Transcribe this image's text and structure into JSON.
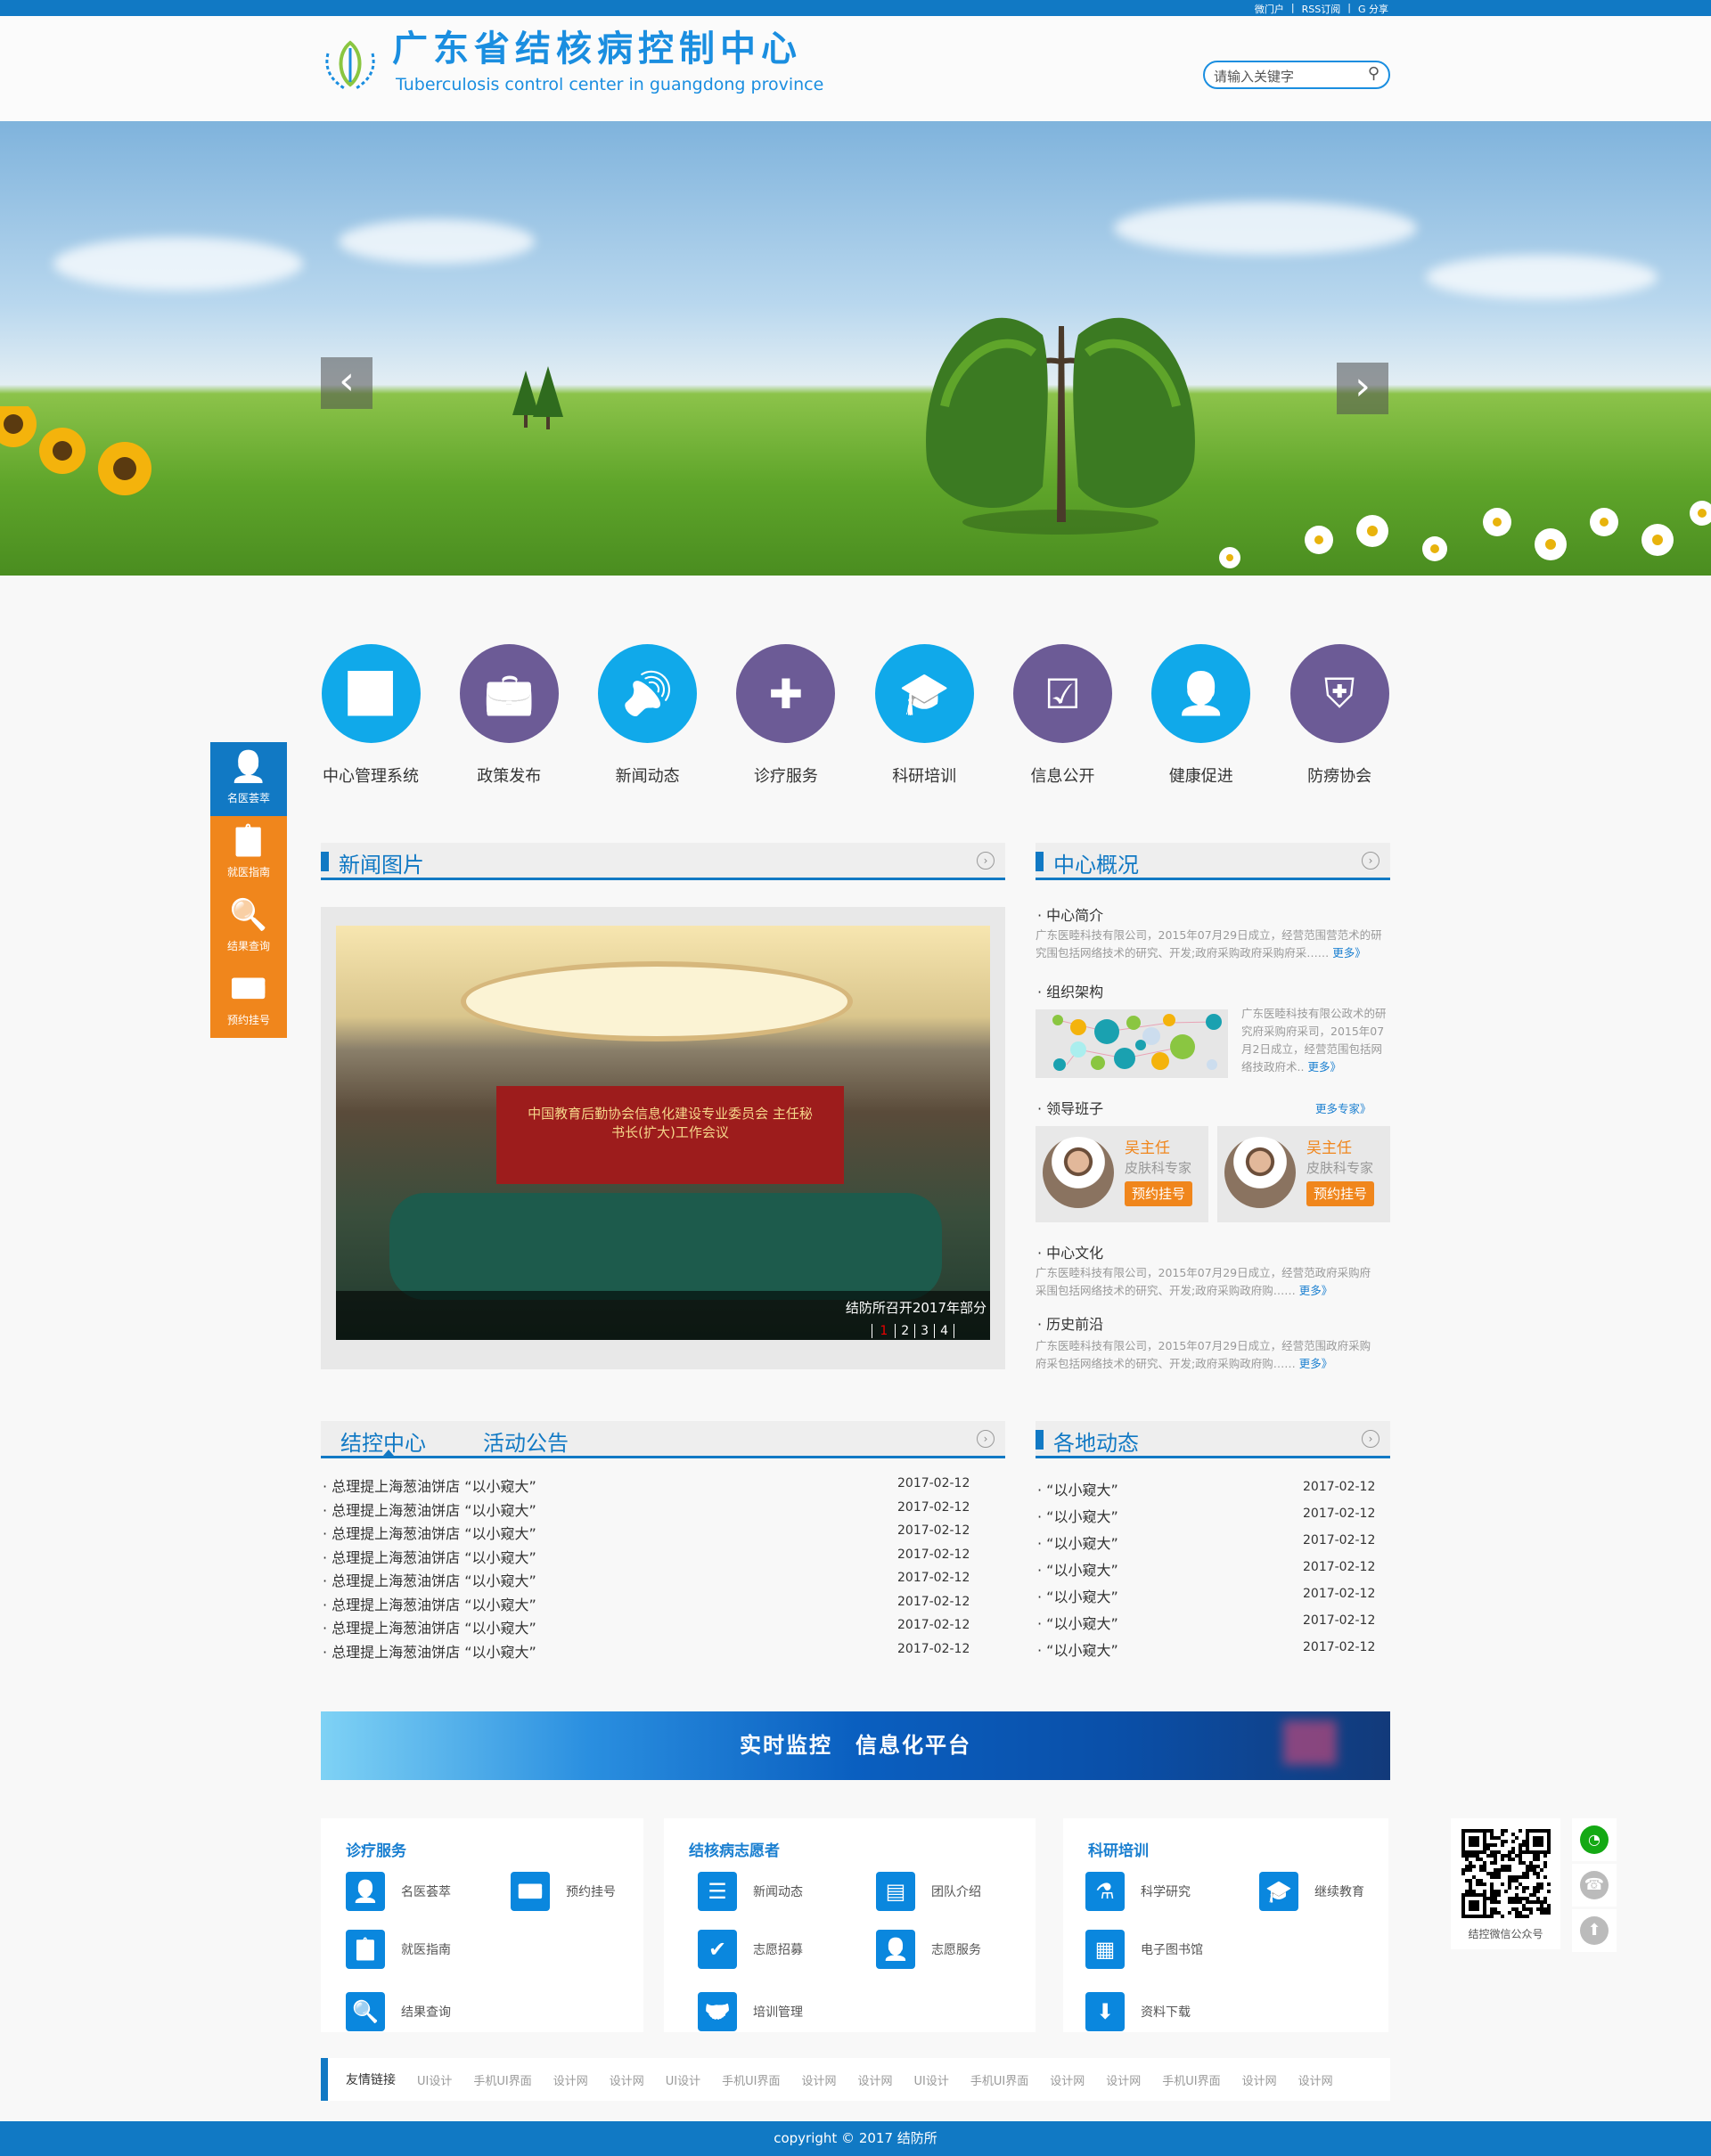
{
  "topbar": {
    "links": [
      "微门户",
      "RSS订阅",
      "分享"
    ]
  },
  "header": {
    "title_cn": "广东省结核病控制中心",
    "title_en": "Tuberculosis control center in guangdong province",
    "search_placeholder": "请输入关键字"
  },
  "hero": {
    "prev": "‹",
    "next": "›"
  },
  "nav": [
    {
      "label": "中心管理系统",
      "icon": "chart-growth-icon",
      "color": "#10a9ea"
    },
    {
      "label": "政策发布",
      "icon": "briefcase-icon",
      "color": "#6c5b96"
    },
    {
      "label": "新闻动态",
      "icon": "speaker-icon",
      "color": "#10a9ea"
    },
    {
      "label": "诊疗服务",
      "icon": "medical-kit-icon",
      "color": "#6c5b96"
    },
    {
      "label": "科研培训",
      "icon": "graduation-cap-icon",
      "color": "#10a9ea"
    },
    {
      "label": "信息公开",
      "icon": "document-check-icon",
      "color": "#6c5b96"
    },
    {
      "label": "健康促进",
      "icon": "doctor-icon",
      "color": "#10a9ea"
    },
    {
      "label": "防痨协会",
      "icon": "shield-cross-icon",
      "color": "#6c5b96"
    }
  ],
  "sidebar": [
    {
      "label": "名医荟萃",
      "icon": "doctor-icon",
      "color": "#1179c4"
    },
    {
      "label": "就医指南",
      "icon": "clipboard-icon",
      "color": "#f0861c"
    },
    {
      "label": "结果查询",
      "icon": "search-card-icon",
      "color": "#f0861c"
    },
    {
      "label": "预约挂号",
      "icon": "id-card-phone-icon",
      "color": "#f0861c"
    }
  ],
  "news_pictures": {
    "title": "新闻图片",
    "caption": "结防所召开2017年部分",
    "banner_text": "中国教育后勤协会信息化建设专业委员会 主任秘书长(扩大)工作会议",
    "pages": [
      "1",
      "2",
      "3",
      "4"
    ],
    "active_page": "1"
  },
  "overview": {
    "title": "中心概况",
    "intro_title": "中心简介",
    "intro_text": "广东医睦科技有限公司，2015年07月29日成立，经营范围营范术的研究围包括网络技术的研究、开发;政府采购政府采购府采……",
    "org_title": "组织架构",
    "org_text": "广东医睦科技有限公政术的研究府采购府采司，2015年07月2日成立，经营范围包括网络技政府术..",
    "leaders_title": "领导班子",
    "more_experts": "更多专家》",
    "leaders": [
      {
        "name": "吴主任",
        "dept": "皮肤科专家",
        "button": "预约挂号"
      },
      {
        "name": "吴主任",
        "dept": "皮肤科专家",
        "button": "预约挂号"
      }
    ],
    "culture_title": "中心文化",
    "culture_text": "广东医睦科技有限公司，2015年07月29日成立，经营范政府采购府采围包括网络技术的研究、开发;政府采购政府购……",
    "history_title": "历史前沿",
    "history_text": "广东医睦科技有限公司，2015年07月29日成立，经营范围政府采购府采包括网络技术的研究、开发;政府采购政府购……",
    "more": "更多》"
  },
  "tabs": {
    "tab1": "结控中心",
    "tab2": "活动公告",
    "items": [
      {
        "title": "总理提上海葱油饼店 “以小窥大”",
        "date": "2017-02-12"
      },
      {
        "title": "总理提上海葱油饼店 “以小窥大”",
        "date": "2017-02-12"
      },
      {
        "title": "总理提上海葱油饼店 “以小窥大”",
        "date": "2017-02-12"
      },
      {
        "title": "总理提上海葱油饼店 “以小窥大”",
        "date": "2017-02-12"
      },
      {
        "title": "总理提上海葱油饼店 “以小窥大”",
        "date": "2017-02-12"
      },
      {
        "title": "总理提上海葱油饼店 “以小窥大”",
        "date": "2017-02-12"
      },
      {
        "title": "总理提上海葱油饼店 “以小窥大”",
        "date": "2017-02-12"
      },
      {
        "title": "总理提上海葱油饼店 “以小窥大”",
        "date": "2017-02-12"
      }
    ]
  },
  "local_news": {
    "title": "各地动态",
    "items": [
      {
        "title": "“以小窥大”",
        "date": "2017-02-12"
      },
      {
        "title": "“以小窥大”",
        "date": "2017-02-12"
      },
      {
        "title": "“以小窥大”",
        "date": "2017-02-12"
      },
      {
        "title": "“以小窥大”",
        "date": "2017-02-12"
      },
      {
        "title": "“以小窥大”",
        "date": "2017-02-12"
      },
      {
        "title": "“以小窥大”",
        "date": "2017-02-12"
      },
      {
        "title": "“以小窥大”",
        "date": "2017-02-12"
      }
    ]
  },
  "banner": {
    "text": "实时监控　信息化平台"
  },
  "services": [
    {
      "title": "诊疗服务",
      "items": [
        {
          "label": "名医荟萃",
          "icon": "doctor-icon"
        },
        {
          "label": "预约挂号",
          "icon": "id-card-phone-icon"
        },
        {
          "label": "就医指南",
          "icon": "clipboard-icon"
        },
        {
          "label": "结果查询",
          "icon": "search-card-icon"
        }
      ]
    },
    {
      "title": "结核病志愿者",
      "items": [
        {
          "label": "新闻动态",
          "icon": "news-icon"
        },
        {
          "label": "团队介绍",
          "icon": "team-doc-icon"
        },
        {
          "label": "志愿招募",
          "icon": "calendar-check-icon"
        },
        {
          "label": "志愿服务",
          "icon": "user-check-icon"
        },
        {
          "label": "培训管理",
          "icon": "handshake-icon"
        }
      ]
    },
    {
      "title": "科研培训",
      "items": [
        {
          "label": "科学研究",
          "icon": "flask-icon"
        },
        {
          "label": "继续教育",
          "icon": "graduation-cap-icon"
        },
        {
          "label": "电子图书馆",
          "icon": "library-icon"
        },
        {
          "label": "资料下载",
          "icon": "download-icon"
        }
      ]
    }
  ],
  "qr": {
    "caption": "结控微信公众号"
  },
  "friend_links": {
    "title": "友情链接",
    "items": [
      "UI设计",
      "手机UI界面",
      "设计网",
      "设计网",
      "UI设计",
      "手机UI界面",
      "设计网",
      "设计网",
      "UI设计",
      "手机UI界面",
      "设计网",
      "设计网",
      "手机UI界面",
      "设计网",
      "设计网"
    ]
  },
  "footer": {
    "copyright": "copyright © 2017 结防所"
  },
  "colors": {
    "primary": "#1179c4",
    "accent": "#f0861c",
    "purple": "#6c5b96",
    "cyan": "#10a9ea"
  }
}
